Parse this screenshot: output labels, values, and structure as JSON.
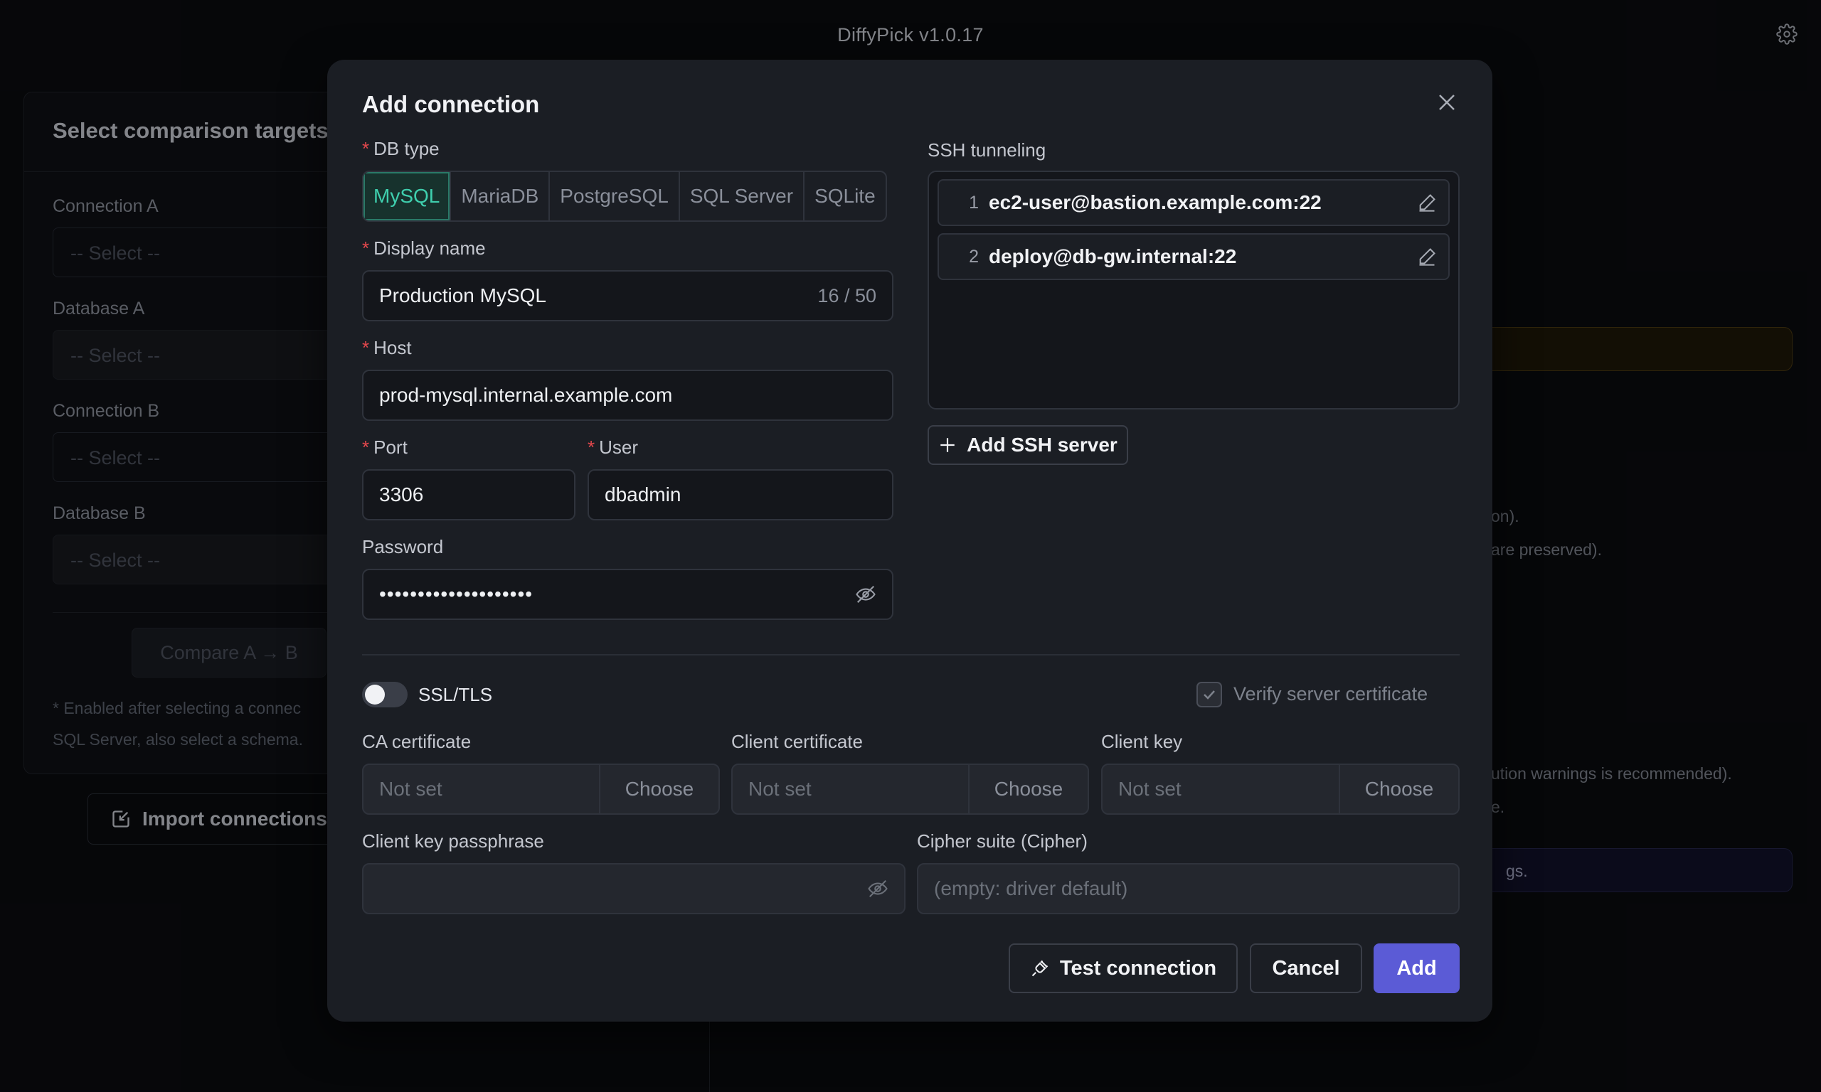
{
  "app": {
    "title": "DiffyPick v1.0.17"
  },
  "background": {
    "panel_title": "Select comparison targets",
    "connection_a_label": "Connection A",
    "database_a_label": "Database A",
    "connection_b_label": "Connection B",
    "database_b_label": "Database B",
    "select_placeholder": "-- Select --",
    "compare_button": "Compare A → B",
    "note_line1": "* Enabled after selecting a connec",
    "note_line2": "SQL Server, also select a schema.",
    "import_button": "Import connections",
    "right_text_1": "on).",
    "right_text_2": "are preserved).",
    "right_text_3": "ution warnings is recommended).",
    "right_text_4": "e.",
    "right_info": "gs."
  },
  "modal": {
    "title": "Add connection",
    "db_type_label": "DB type",
    "db_types": [
      "MySQL",
      "MariaDB",
      "PostgreSQL",
      "SQL Server",
      "SQLite"
    ],
    "db_type_selected": "MySQL",
    "display_name_label": "Display name",
    "display_name_value": "Production MySQL",
    "display_name_counter": "16 / 50",
    "host_label": "Host",
    "host_value": "prod-mysql.internal.example.com",
    "port_label": "Port",
    "port_value": "3306",
    "user_label": "User",
    "user_value": "dbadmin",
    "password_label": "Password",
    "password_value": "••••••••••••••••••••",
    "ssh_label": "SSH tunneling",
    "ssh_servers": [
      {
        "index": "1",
        "address": "ec2-user@bastion.example.com:22"
      },
      {
        "index": "2",
        "address": "deploy@db-gw.internal:22"
      }
    ],
    "add_ssh_button": "Add SSH server",
    "ssl_label": "SSL/TLS",
    "ssl_enabled": false,
    "verify_cert_label": "Verify server certificate",
    "verify_cert_checked": true,
    "ca_cert_label": "CA certificate",
    "client_cert_label": "Client certificate",
    "client_key_label": "Client key",
    "not_set": "Not set",
    "choose": "Choose",
    "passphrase_label": "Client key passphrase",
    "cipher_label": "Cipher suite (Cipher)",
    "cipher_placeholder": "(empty: driver default)",
    "test_button": "Test connection",
    "cancel_button": "Cancel",
    "add_button": "Add"
  },
  "colors": {
    "accent": "#5b5bd6",
    "mysql_active": "#3fcfae",
    "required": "#e5484d"
  }
}
